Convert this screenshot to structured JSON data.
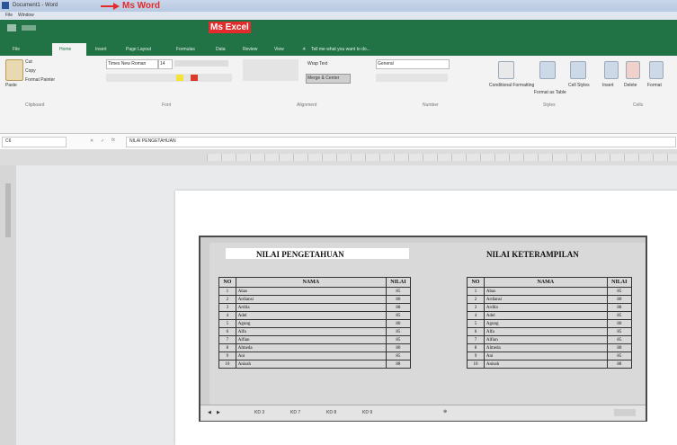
{
  "annotations": {
    "word": "Ms Word",
    "excel": "Ms Excel"
  },
  "word": {
    "title": "Document1 - Word",
    "menu": [
      "File",
      "Window"
    ]
  },
  "excel": {
    "tabs": [
      "File",
      "Home",
      "Insert",
      "Page Layout",
      "Formulas",
      "Data",
      "Review",
      "View"
    ],
    "tell_me": "Tell me what you want to do...",
    "clipboard": {
      "paste": "Paste",
      "cut": "Cut",
      "copy": "Copy",
      "format_painter": "Format Painter"
    },
    "font": {
      "name": "Times New Roman",
      "size": "14"
    },
    "wrap_text": "Wrap Text",
    "merge_center": "Merge & Center",
    "number_format": "General",
    "styles": [
      "Conditional Formatting",
      "Format as Table",
      "Cell Styles"
    ],
    "cells": [
      "Insert",
      "Delete",
      "Format"
    ],
    "group_labels": [
      "Clipboard",
      "Font",
      "Alignment",
      "Number",
      "Styles",
      "Cells"
    ],
    "name_box": "C6",
    "formula": "NILAI PENGETAHUAN"
  },
  "sheet": {
    "title_left": "NILAI PENGETAHUAN",
    "title_right": "NILAI KETERAMPILAN",
    "headers": [
      "NO",
      "NAMA",
      "NILAI"
    ],
    "rows": [
      [
        "1",
        "Abas",
        "85"
      ],
      [
        "2",
        "Ardiansi",
        "80"
      ],
      [
        "3",
        "Ardila",
        "88"
      ],
      [
        "4",
        "Adel",
        "85"
      ],
      [
        "5",
        "Agung",
        "80"
      ],
      [
        "6",
        "Alfa",
        "85"
      ],
      [
        "7",
        "Alfian",
        "85"
      ],
      [
        "8",
        "Almeda",
        "80"
      ],
      [
        "9",
        "Ani",
        "85"
      ],
      [
        "10",
        "Anisah",
        "88"
      ]
    ],
    "sheet_tabs": [
      "KD 3",
      "KD 7",
      "KD 8",
      "KD 9"
    ]
  }
}
